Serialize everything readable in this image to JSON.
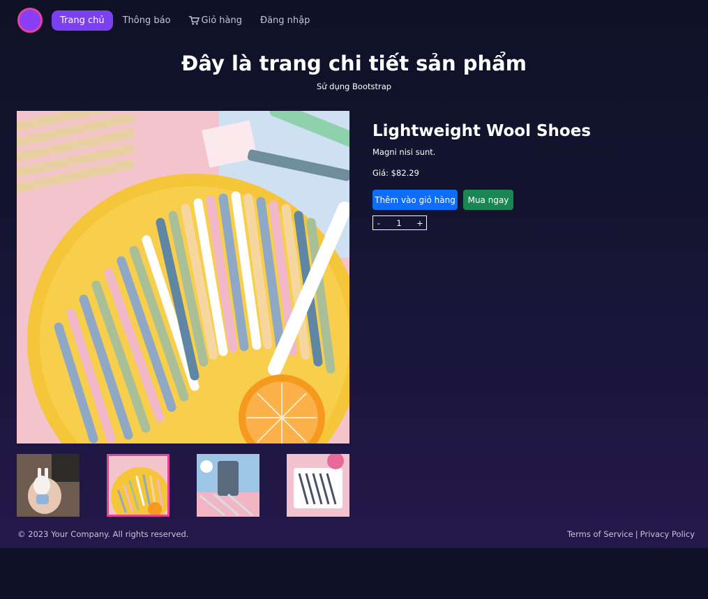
{
  "nav": {
    "items": [
      {
        "label": "Trang chủ",
        "active": true
      },
      {
        "label": "Thông báo",
        "active": false
      },
      {
        "label": "Giỏ hàng",
        "icon": "cart-icon",
        "active": false
      },
      {
        "label": "Đăng nhập",
        "active": false
      }
    ]
  },
  "hero": {
    "title": "Đây là trang chi tiết sản phẩm",
    "subtitle": "Sử dụng Bootstrap"
  },
  "product": {
    "name": "Lightweight Wool Shoes",
    "description": "Magni nisi sunt.",
    "price_text": "Giá: $82.29",
    "add_to_cart_label": "Thêm vào giỏ hàng",
    "buy_now_label": "Mua ngay",
    "quantity": {
      "minus": "-",
      "value": "1",
      "plus": "+"
    },
    "thumbnails": [
      {
        "name": "thumbnail-1",
        "selected": false
      },
      {
        "name": "thumbnail-2",
        "selected": true
      },
      {
        "name": "thumbnail-3",
        "selected": false
      },
      {
        "name": "thumbnail-4",
        "selected": false
      }
    ]
  },
  "footer": {
    "copyright": "© 2023 Your Company. All rights reserved.",
    "terms": "Terms of Service",
    "separator": "|",
    "privacy": "Privacy Policy"
  },
  "colors": {
    "background": "#0f1126",
    "accent": "#7b41f0",
    "logo_border": "#e3449a",
    "primary_button": "#0d6efd",
    "success_button": "#198754"
  }
}
